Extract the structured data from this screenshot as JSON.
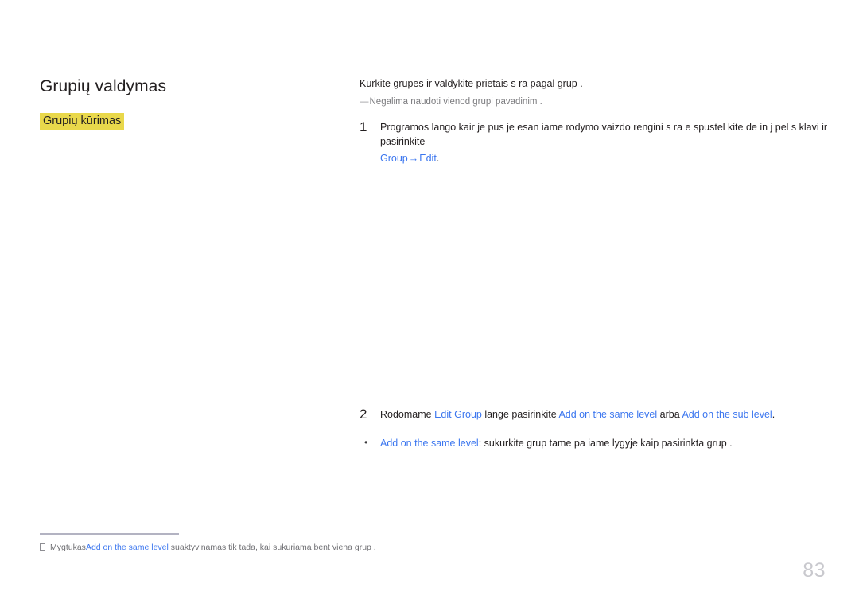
{
  "document": {
    "title": "Grupių valdymas",
    "section_title": "Grupių kūrimas",
    "page_number": "83"
  },
  "colors": {
    "highlight": "#e9d84b",
    "link": "#3b76ef",
    "text": "#231f20",
    "muted": "#7d7d80",
    "page_number": "#c9c9ce",
    "rule": "#b3b3c2"
  },
  "content": {
    "intro": "Kurkite grupes ir valdykite prietais  s ra   pagal grup .",
    "note": {
      "dash": "―",
      "text": "Negalima naudoti vienod  grupi  pavadinim ."
    },
    "steps": [
      {
        "number": "1",
        "text": "Programos lango kair je pus je esan iame rodymo vaizdo  rengini  s ra e spustel kite de in j  pel s klavi   ir pasirinkite",
        "continuation": {
          "link_before": "Group",
          "arrow": "→",
          "link_after": "Edit",
          "period": "."
        }
      },
      {
        "number": "2",
        "prefix": "Rodomame ",
        "link1": "Edit Group",
        "mid1": " lange pasirinkite ",
        "link2": "Add on the same level",
        "mid2": " arba ",
        "link3": "Add on the sub level",
        "suffix": "."
      }
    ],
    "bullets": [
      {
        "marker": "•",
        "link": "Add on the same level",
        "text": ": sukurkite grup  tame pa iame lygyje kaip pasirinkta grup ."
      }
    ],
    "footnote": {
      "marker": "※",
      "prefix": "Mygtukas",
      "link": "Add on the same level",
      "suffix": " suaktyvinamas tik tada, kai sukuriama bent viena grup ."
    }
  }
}
